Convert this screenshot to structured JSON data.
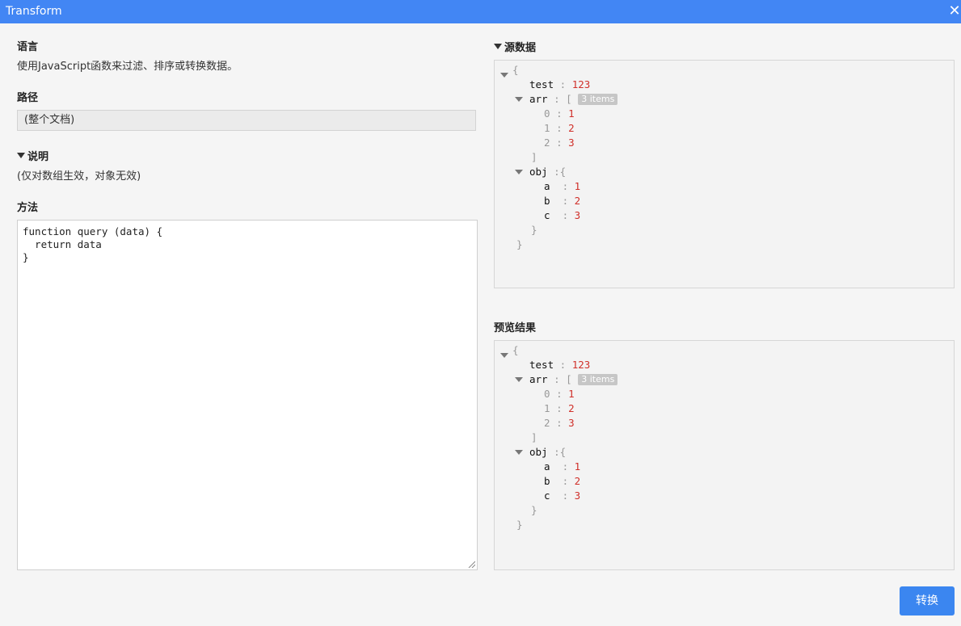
{
  "window": {
    "title": "Transform"
  },
  "left": {
    "language_label": "语言",
    "language_desc": "使用JavaScript函数来过滤、排序或转换数据。",
    "path_label": "路径",
    "path_value": "(整个文档)",
    "note_label": "说明",
    "note_text": "(仅对数组生效，对象无效)",
    "method_label": "方法",
    "method_code": "function query (data) {\n  return data\n}"
  },
  "source": {
    "label": "源数据",
    "open_brace": "{",
    "test_key": "test",
    "test_val": "123",
    "arr_key": "arr",
    "arr_open": "[",
    "arr_badge": "3 items",
    "arr": [
      {
        "k": "0",
        "v": "1"
      },
      {
        "k": "1",
        "v": "2"
      },
      {
        "k": "2",
        "v": "3"
      }
    ],
    "arr_close": "]",
    "obj_key": "obj",
    "obj_open": "{",
    "obj": [
      {
        "k": "a",
        "v": "1"
      },
      {
        "k": "b",
        "v": "2"
      },
      {
        "k": "c",
        "v": "3"
      }
    ],
    "obj_close": "}",
    "close_brace": "}"
  },
  "preview": {
    "label": "预览结果",
    "open_brace": "{",
    "test_key": "test",
    "test_val": "123",
    "arr_key": "arr",
    "arr_open": "[",
    "arr_badge": "3 items",
    "arr": [
      {
        "k": "0",
        "v": "1"
      },
      {
        "k": "1",
        "v": "2"
      },
      {
        "k": "2",
        "v": "3"
      }
    ],
    "arr_close": "]",
    "obj_key": "obj",
    "obj_open": "{",
    "obj": [
      {
        "k": "a",
        "v": "1"
      },
      {
        "k": "b",
        "v": "2"
      },
      {
        "k": "c",
        "v": "3"
      }
    ],
    "obj_close": "}",
    "close_brace": "}"
  },
  "colon": ":",
  "actions": {
    "convert_label": "转换"
  },
  "colors": {
    "titlebar": "#4286f4",
    "button": "#3b86f0",
    "number": "#d0302a",
    "badge": "#c6c6c6"
  }
}
